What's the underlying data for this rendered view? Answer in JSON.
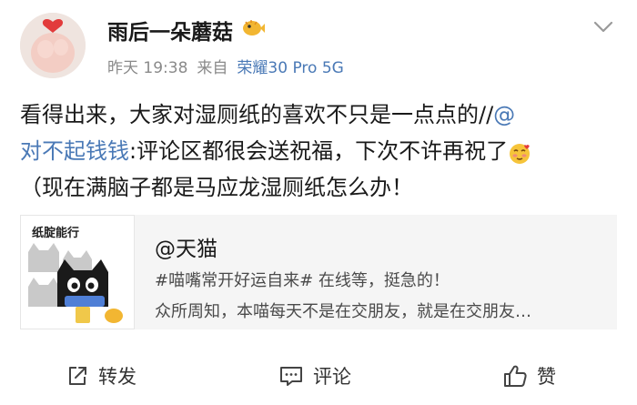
{
  "author": {
    "name": "雨后一朵蘑菇",
    "time": "昨天 19:38",
    "source_prefix": "来自",
    "device": "荣耀30 Pro 5G"
  },
  "post": {
    "line1": "看得出来，大家对湿厕纸的喜欢不只是一点点的//",
    "mention_at": "@",
    "mention_name": "对不起钱钱",
    "line2_rest": ":评论区都很会送祝福，下次不许再祝了",
    "line3": "（现在满脑子都是马应龙湿厕纸怎么办！"
  },
  "card": {
    "thumb_title": "纸腚能行",
    "title": "@天猫",
    "line1": "#喵嘴常开好运自来# 在线等，挺急的！",
    "line2": "众所周知，本喵每天不是在交朋友，就是在交朋友…"
  },
  "actions": {
    "repost": "转发",
    "comment": "评论",
    "like": "赞"
  },
  "icons": {
    "author_badge": "pufferfish-icon",
    "more": "chevron-down-icon",
    "emoji": "blushing-face-icon",
    "repost": "share-icon",
    "comment": "comment-icon",
    "like": "thumbs-up-icon"
  }
}
